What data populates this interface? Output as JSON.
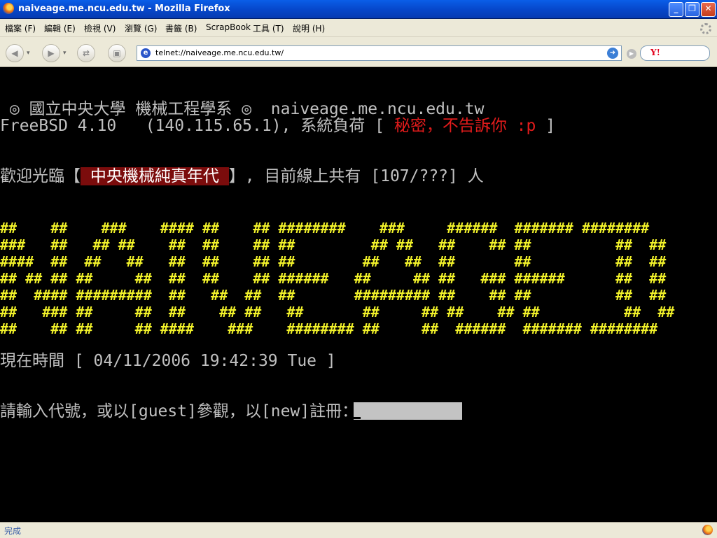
{
  "window": {
    "title": "naiveage.me.ncu.edu.tw - Mozilla Firefox"
  },
  "menu": [
    {
      "label": "檔案 (F)"
    },
    {
      "label": "編輯 (E)"
    },
    {
      "label": "檢視 (V)"
    },
    {
      "label": "瀏覽 (G)"
    },
    {
      "label": "書籤 (B)"
    },
    {
      "label": "ScrapBook"
    },
    {
      "label": "工具 (T)"
    },
    {
      "label": "說明 (H)"
    }
  ],
  "navbar": {
    "url": "telnet://naiveage.me.ncu.edu.tw/",
    "search_engine_icon": "Y!"
  },
  "terminal": {
    "line1": " ◎ 國立中央大學 機械工程學系 ◎  naiveage.me.ncu.edu.tw",
    "line2_prefix": "FreeBSD 4.10   (140.115.65.1), 系統負荷 [ ",
    "line2_secret": "秘密，不告訴你 :p",
    "line2_suffix": " ]",
    "welcome_prefix": "歡迎光臨【",
    "welcome_name": " 中央機械純真年代 ",
    "welcome_suffix": "】, 目前線上共有 [107/???] 人",
    "ascii_art": [
      "##    ##    ###    #### ##    ## ########    ###     ######  ####### ########",
      "###   ##   ## ##    ##  ##    ## ##         ## ##   ##    ## ##          ##  ##",
      "####  ##  ##   ##   ##  ##    ## ##        ##   ##  ##       ##          ##  ##",
      "## ## ## ##     ##  ##  ##    ## ######   ##     ## ##   ### ######      ##  ##",
      "##  #### #########  ##   ##  ##  ##       ######### ##    ## ##          ##  ##",
      "##   ### ##     ##  ##    ## ##   ##       ##     ## ##    ## ##          ##  ##",
      "##    ## ##     ## ####    ###    ######## ##     ##  ######  ####### ########"
    ],
    "time_label": "現在時間 [ 04/11/2006 19:42:39 Tue ]",
    "login_prompt": "請輸入代號，或以[guest]參觀，以[new]註冊："
  },
  "status": {
    "text": "完成"
  },
  "colors": {
    "terminal_bg": "#000000",
    "terminal_fg": "#c0c0c0",
    "art": "#f2f22a",
    "secret": "#e11b1b",
    "highlight_bg": "#7b0c0c"
  },
  "icons": [
    "firefox-icon",
    "back-icon",
    "forward-icon",
    "reload-icon",
    "stop-icon",
    "telnet-site-icon",
    "go-icon",
    "yahoo-search-icon"
  ]
}
